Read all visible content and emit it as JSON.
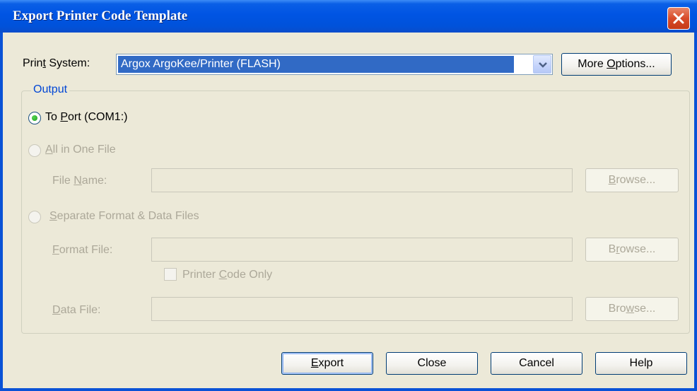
{
  "window": {
    "title": "Export Printer Code Template"
  },
  "print_system": {
    "label_pre": "Prin",
    "label_u": "t",
    "label_post": " System:",
    "selected_value": "Argox ArgoKee/Printer (FLASH)"
  },
  "buttons": {
    "more_options": {
      "pre": "More ",
      "u": "O",
      "post": "ptions..."
    },
    "export": {
      "pre": "",
      "u": "E",
      "post": "xport"
    },
    "close": "Close",
    "cancel": "Cancel",
    "help": "Help"
  },
  "output": {
    "group_title": "Output",
    "to_port": {
      "pre": "To ",
      "u": "P",
      "post": "ort (COM1:)",
      "checked": true
    },
    "all_in_one": {
      "pre": "",
      "u": "A",
      "post": "ll in One File",
      "checked": false
    },
    "file_name_label": {
      "pre": "File ",
      "u": "N",
      "post": "ame:"
    },
    "file_name_value": "",
    "browse1": {
      "pre": "",
      "u": "B",
      "post": "rowse..."
    },
    "separate": {
      "pre": "",
      "u": "S",
      "post": "eparate Format & Data Files",
      "checked": false
    },
    "format_file_label": {
      "pre": "",
      "u": "F",
      "post": "ormat File:"
    },
    "format_file_value": "",
    "browse2": {
      "pre": "B",
      "u": "r",
      "post": "owse..."
    },
    "printer_code_only": {
      "pre": "Printer ",
      "u": "C",
      "post": "ode Only",
      "checked": false
    },
    "data_file_label": {
      "pre": "",
      "u": "D",
      "post": "ata File:"
    },
    "data_file_value": "",
    "browse3": {
      "pre": "Bro",
      "u": "w",
      "post": "se..."
    }
  }
}
